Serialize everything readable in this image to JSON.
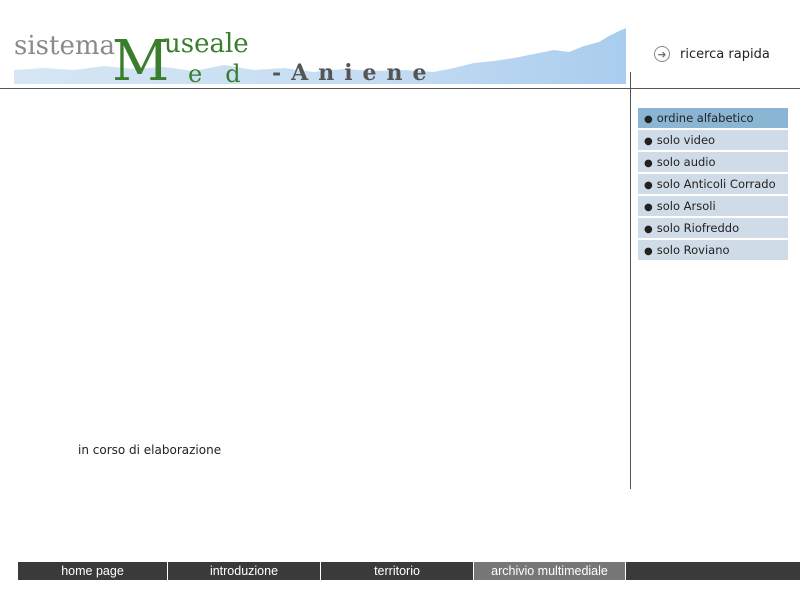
{
  "header": {
    "logo": {
      "word1": "sistema",
      "initial": "M",
      "word2": "useale",
      "word3": "ed",
      "word4": "-Aniene"
    },
    "quick_search_label": "ricerca rapida"
  },
  "sidebar": {
    "items": [
      {
        "label": "ordine alfabetico",
        "active": true
      },
      {
        "label": "solo video"
      },
      {
        "label": "solo audio"
      },
      {
        "label": "solo Anticoli Corrado"
      },
      {
        "label": "solo Arsoli"
      },
      {
        "label": "solo Riofreddo"
      },
      {
        "label": "solo Roviano"
      }
    ]
  },
  "main": {
    "status": "in corso di elaborazione"
  },
  "footer": {
    "nav": [
      {
        "label": "home page"
      },
      {
        "label": "introduzione"
      },
      {
        "label": "territorio"
      },
      {
        "label": "archivio multimediale",
        "active": true
      }
    ]
  },
  "colors": {
    "accent_green": "#3a7d2c",
    "menu_active": "#8ab5d3",
    "menu_bg": "#cfdbe6",
    "nav_bg": "#3a3a3a",
    "nav_active": "#777777"
  }
}
